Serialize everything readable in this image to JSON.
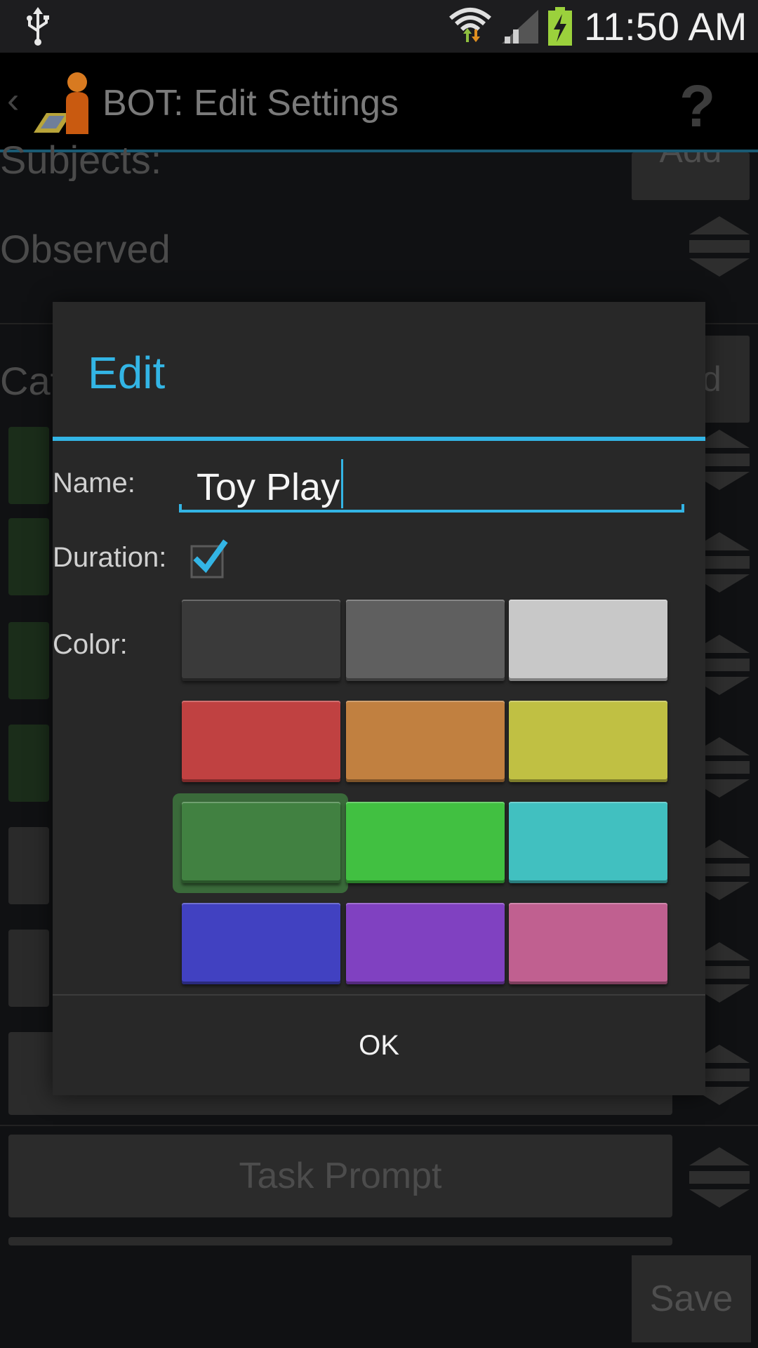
{
  "status_bar": {
    "time": "11:50 AM",
    "icons": [
      "usb-icon",
      "wifi-icon",
      "signal-icon",
      "battery-charging-icon"
    ]
  },
  "action_bar": {
    "back_glyph": "‹",
    "title": "BOT: Edit Settings",
    "help_glyph": "?"
  },
  "background": {
    "subjects_label": "Subjects:",
    "subjects_add": "Add",
    "observed_label": "Observed",
    "categories_label_partial": "Cat",
    "categories_add_partial": "d",
    "task_prompt": "Task Prompt",
    "save": "Save"
  },
  "dialog": {
    "title": "Edit",
    "name_label": "Name:",
    "name_value": "Toy Play",
    "duration_label": "Duration:",
    "duration_checked": true,
    "color_label": "Color:",
    "ok": "OK",
    "colors": [
      {
        "name": "dark-gray",
        "hex": "#3a3a3a"
      },
      {
        "name": "gray",
        "hex": "#5f5f5f"
      },
      {
        "name": "light-gray",
        "hex": "#c8c8c8"
      },
      {
        "name": "red",
        "hex": "#c04141"
      },
      {
        "name": "orange",
        "hex": "#c18040"
      },
      {
        "name": "yellow",
        "hex": "#c0c043"
      },
      {
        "name": "dark-green",
        "hex": "#418141"
      },
      {
        "name": "green",
        "hex": "#41c041"
      },
      {
        "name": "cyan",
        "hex": "#41c0c0"
      },
      {
        "name": "blue",
        "hex": "#4141c1"
      },
      {
        "name": "purple",
        "hex": "#8041c1"
      },
      {
        "name": "pink",
        "hex": "#c06090"
      }
    ],
    "selected_color": "dark-green"
  },
  "accent_color": "#33b5e5"
}
